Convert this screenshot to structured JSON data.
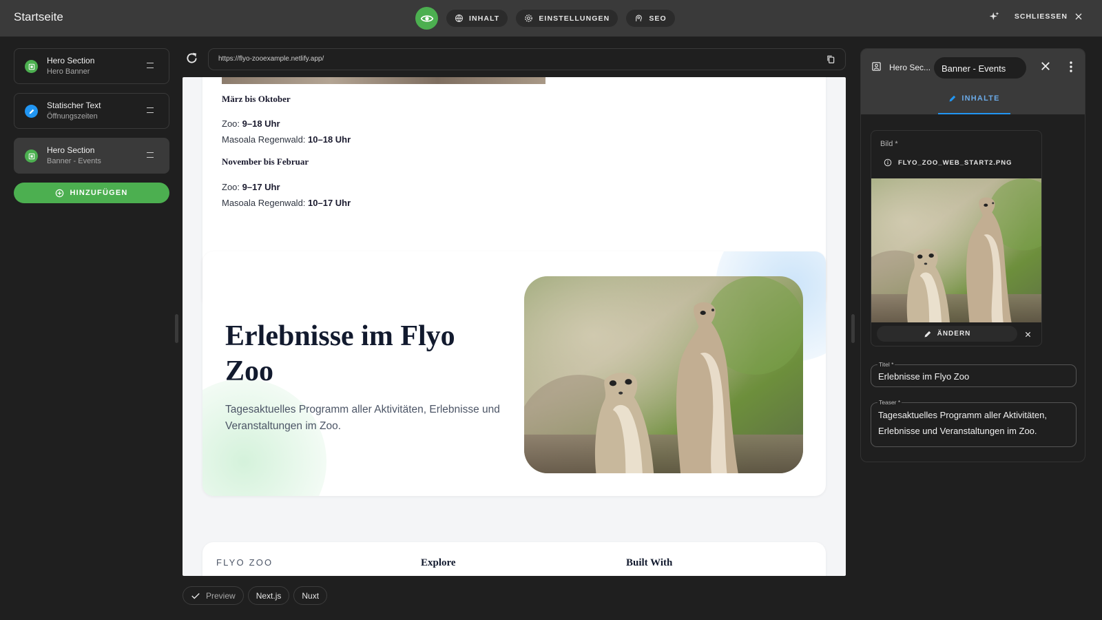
{
  "header": {
    "title": "Startseite",
    "tabs": [
      {
        "label": "INHALT",
        "icon": "globe-icon"
      },
      {
        "label": "EINSTELLUNGEN",
        "icon": "gear-icon"
      },
      {
        "label": "SEO",
        "icon": "seo-icon"
      }
    ],
    "close_label": "SCHLIESSEN"
  },
  "sidebar": {
    "items": [
      {
        "title": "Hero Section",
        "subtitle": "Hero Banner",
        "icon": "image-block-icon",
        "color": "#4caf50"
      },
      {
        "title": "Statischer Text",
        "subtitle": "Öffnungszeiten",
        "icon": "pencil-icon",
        "color": "#2196f3"
      },
      {
        "title": "Hero Section",
        "subtitle": "Banner - Events",
        "icon": "image-block-icon",
        "color": "#4caf50",
        "active": true
      }
    ],
    "add_label": "HINZUFÜGEN"
  },
  "browser": {
    "url": "https://flyo-zooexample.netlify.app/"
  },
  "preview": {
    "season1": {
      "heading": "März bis Oktober",
      "lines": [
        {
          "label": "Zoo: ",
          "value": "9–18 Uhr"
        },
        {
          "label": "Masoala Regenwald: ",
          "value": "10–18 Uhr"
        }
      ]
    },
    "season2": {
      "heading": "November bis Februar",
      "lines": [
        {
          "label": "Zoo: ",
          "value": "9–17 Uhr"
        },
        {
          "label": "Masoala Regenwald: ",
          "value": "10–17 Uhr"
        }
      ]
    },
    "hero": {
      "title": "Erlebnisse im Flyo Zoo",
      "teaser": "Tagesaktuelles Programm aller Aktivitäten, Erlebnisse und Veranstaltungen im Zoo."
    },
    "footer": {
      "brand": "FLYO ZOO",
      "col2": "Explore",
      "col3": "Built With"
    }
  },
  "bottom_chips": [
    {
      "label": "Preview",
      "selected": true
    },
    {
      "label": "Next.js"
    },
    {
      "label": "Nuxt"
    }
  ],
  "panel": {
    "block_label": "Hero Sec...",
    "block_tab": "Banner - Events",
    "subtab": "INHALTE",
    "image_field": {
      "label": "Bild *",
      "filename": "FLYO_ZOO_WEB_START2.PNG",
      "change_label": "ÄNDERN"
    },
    "title_field": {
      "label": "Titel *",
      "value": "Erlebnisse im Flyo Zoo"
    },
    "teaser_field": {
      "label": "Teaser *",
      "value": "Tagesaktuelles Programm aller Aktivitäten, Erlebnisse und Veranstaltungen im Zoo."
    }
  },
  "colors": {
    "accent_green": "#4caf50",
    "accent_blue": "#2196f3",
    "topbar": "#3a3a3a",
    "background": "#1f1f1f"
  }
}
